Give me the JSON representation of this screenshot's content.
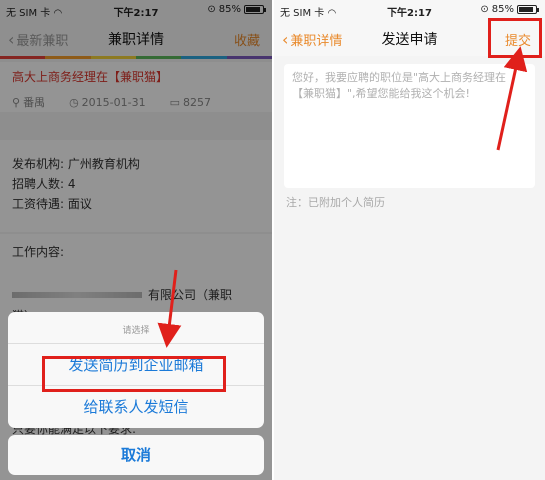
{
  "colors": {
    "accent": "#e98a2c",
    "job_title_red": "#d9342b",
    "sheet_blue": "#1b7ad8",
    "highlight_red": "#e0201b",
    "rainbow": [
      "#e6413a",
      "#f59d2a",
      "#f3d23a",
      "#5cb85c",
      "#2fa7df",
      "#7d5bbd"
    ]
  },
  "left_screen": {
    "status": {
      "carrier": "无 SIM 卡",
      "time": "下午2:17",
      "battery": "85%"
    },
    "nav": {
      "back_label": "最新兼职",
      "title": "兼职详情",
      "right_label": "收藏"
    },
    "job": {
      "title": "高大上商务经理在【兼职猫】",
      "location": "番禺",
      "date": "2015-01-31",
      "views": "8257"
    },
    "details": {
      "publisher": "发布机构: 广州教育机构",
      "headcount": "招聘人数: 4",
      "salary": "工资待遇: 面议"
    },
    "content": {
      "heading": "工作内容:",
      "line1_suffix": "有限公司（兼职",
      "line2": "猫）",
      "line3": "只要你能满足以下要求:"
    },
    "action_sheet": {
      "title": "请选择",
      "option_email": "发送简历到企业邮箱",
      "option_sms": "给联系人发短信",
      "cancel": "取消"
    }
  },
  "right_screen": {
    "status": {
      "carrier": "无 SIM 卡",
      "time": "下午2:17",
      "battery": "85%"
    },
    "nav": {
      "back_label": "兼职详情",
      "title": "发送申请",
      "submit_label": "提交"
    },
    "message": "您好，我要应聘的职位是\"高大上商务经理在【兼职猫】\",希望您能给我这个机会!",
    "note": "注：已附加个人简历"
  },
  "icons": [
    "back-chevron-icon",
    "wifi-icon",
    "lock-rotation-icon",
    "battery-icon",
    "location-pin-icon",
    "clock-icon",
    "views-book-icon",
    "annotation-arrow-icon"
  ]
}
